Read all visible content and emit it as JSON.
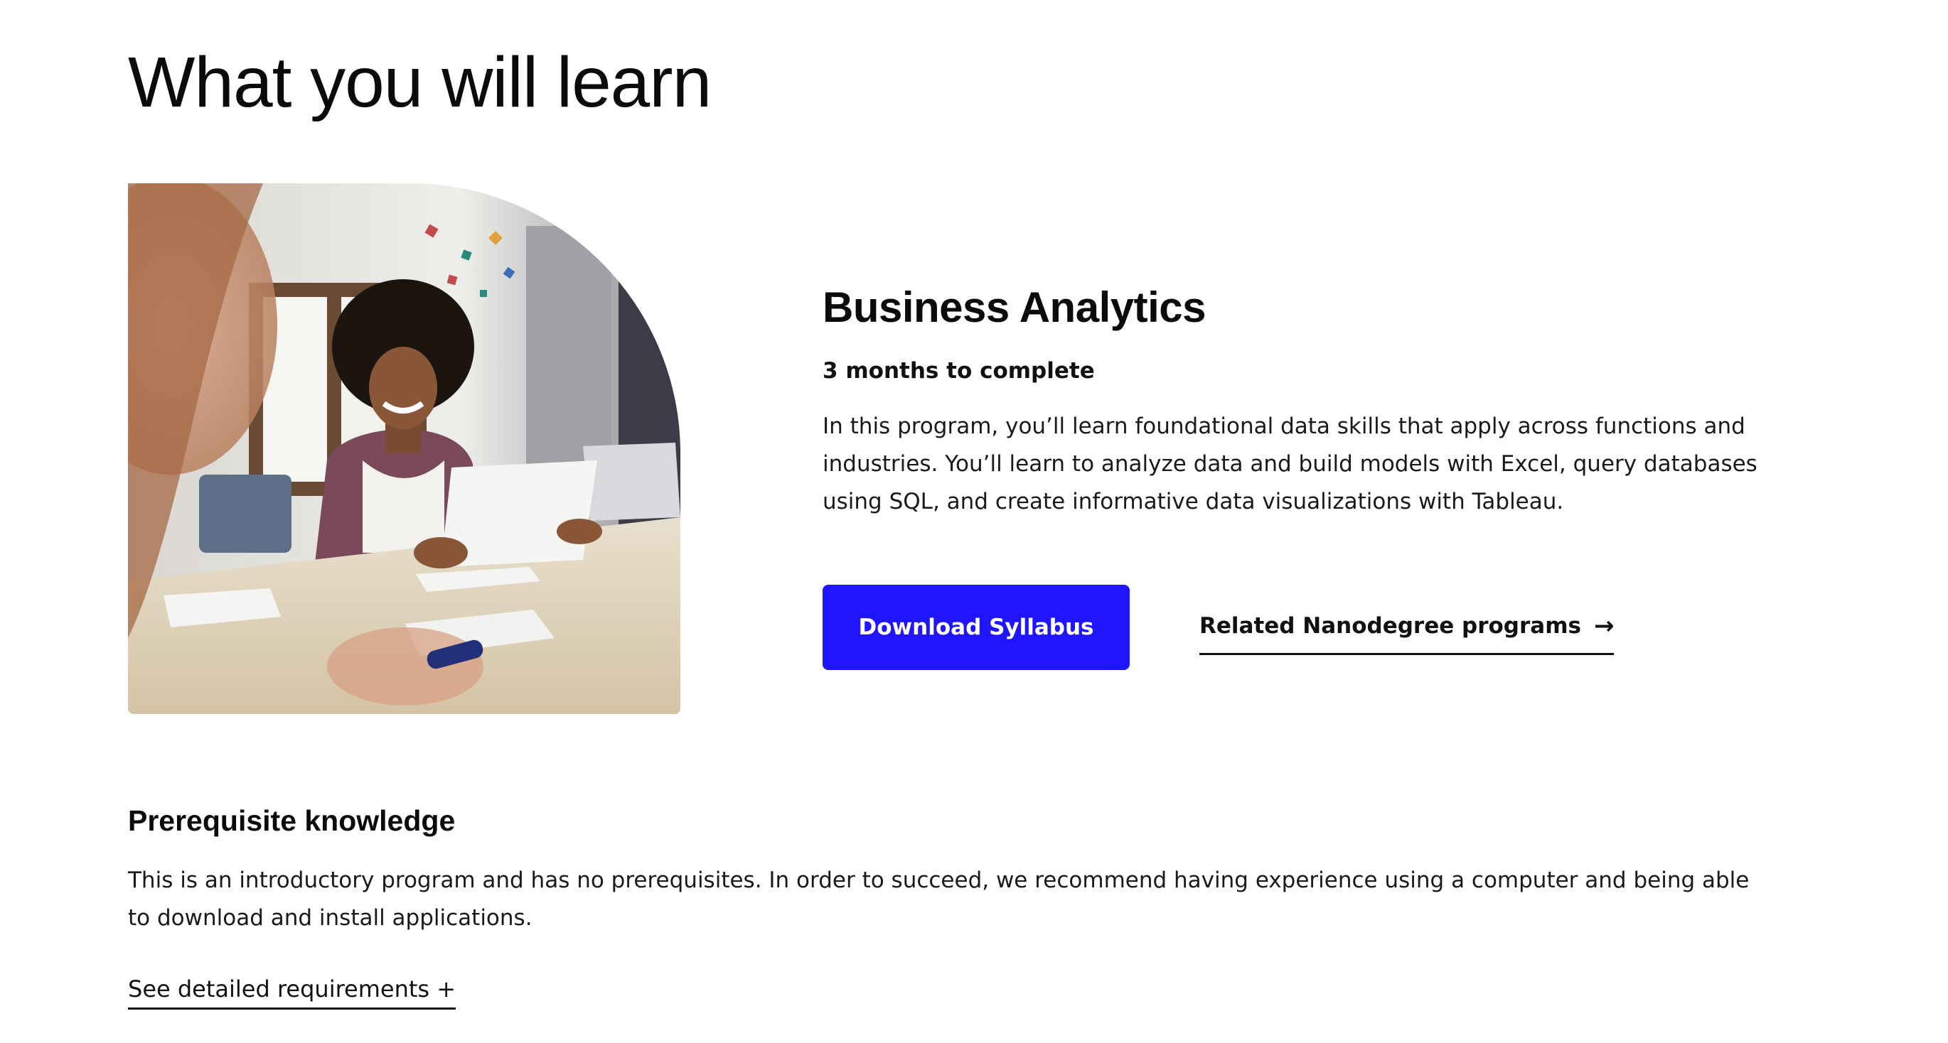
{
  "section": {
    "title": "What you will learn"
  },
  "program": {
    "title": "Business Analytics",
    "duration": "3 months to complete",
    "description": "In this program, you’ll learn foundational data skills that apply across functions and industries. You’ll learn to analyze data and build models with Excel, query databases using SQL, and create informative data visualizations with Tableau.",
    "download_label": "Download Syllabus",
    "related_label": "Related Nanodegree programs",
    "related_icon": "arrow-right-icon",
    "accent_color": "#2015FF"
  },
  "prerequisite": {
    "title": "Prerequisite knowledge",
    "description": "This is an introductory program and has no prerequisites. In order to succeed, we recommend having experience using a computer and being able to download and install applications.",
    "requirements_label": "See detailed requirements +"
  }
}
